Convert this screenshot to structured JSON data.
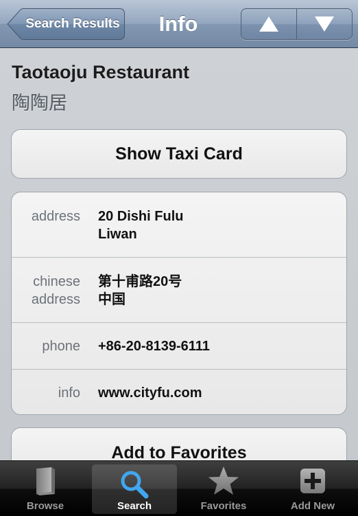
{
  "navbar": {
    "back_label": "Search Results",
    "title": "Info",
    "prev_icon": "triangle-up-icon",
    "next_icon": "triangle-down-icon"
  },
  "place": {
    "name": "Taotaoju Restaurant",
    "name_cn": "陶陶居"
  },
  "buttons": {
    "taxi_card": "Show Taxi Card",
    "add_favorites": "Add to Favorites"
  },
  "details": {
    "address_label": "address",
    "address_line1": "20 Dishi Fulu",
    "address_line2": "Liwan",
    "chinese_address_label_1": "chinese",
    "chinese_address_label_2": "address",
    "chinese_address_line1": "第十甫路20号",
    "chinese_address_line2": "中国",
    "phone_label": "phone",
    "phone_value": "+86-20-8139-6111",
    "info_label": "info",
    "info_value": "www.cityfu.com"
  },
  "tabs": {
    "browse": "Browse",
    "search": "Search",
    "favorites": "Favorites",
    "add_new": "Add New",
    "selected": "Search"
  },
  "colors": {
    "nav_blue": "#8397b1",
    "tab_icon_blue": "#3aa0e8"
  }
}
